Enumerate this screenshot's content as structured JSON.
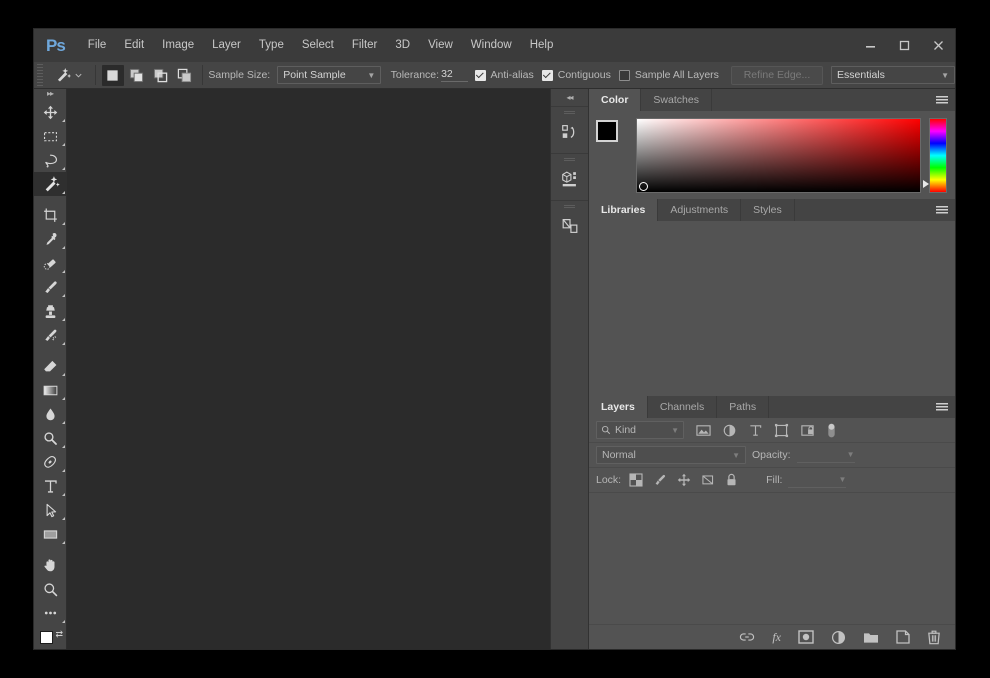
{
  "app": {
    "name": "Adobe Photoshop",
    "logo": "Ps",
    "logo_color": "#6fa8dc",
    "canvas_bg": "#2b2b2b",
    "panel_bg": "#535353",
    "chrome_bg": "#454545"
  },
  "menubar": {
    "items": [
      {
        "label": "File"
      },
      {
        "label": "Edit"
      },
      {
        "label": "Image"
      },
      {
        "label": "Layer"
      },
      {
        "label": "Type"
      },
      {
        "label": "Select"
      },
      {
        "label": "Filter"
      },
      {
        "label": "3D"
      },
      {
        "label": "View"
      },
      {
        "label": "Window"
      },
      {
        "label": "Help"
      }
    ]
  },
  "window_controls": {
    "minimize": "minimize-icon",
    "maximize": "maximize-icon",
    "close": "close-icon"
  },
  "options_bar": {
    "active_tool_icon": "magic-wand-icon",
    "selection_modes": [
      {
        "name": "new-selection",
        "active": true
      },
      {
        "name": "add-to-selection",
        "active": false
      },
      {
        "name": "subtract-from-selection",
        "active": false
      },
      {
        "name": "intersect-with-selection",
        "active": false
      }
    ],
    "sample_size_label": "Sample Size:",
    "sample_size_value": "Point Sample",
    "tolerance_label": "Tolerance:",
    "tolerance_value": "32",
    "anti_alias_label": "Anti-alias",
    "anti_alias_checked": true,
    "contiguous_label": "Contiguous",
    "contiguous_checked": true,
    "sample_all_layers_label": "Sample All Layers",
    "sample_all_layers_checked": false,
    "refine_edge_label": "Refine Edge...",
    "refine_edge_disabled": true,
    "workspace_value": "Essentials"
  },
  "toolbar": {
    "expand_icon": "double-chevron-right-icon",
    "tools": [
      {
        "name": "move-tool",
        "icon": "move-icon",
        "active": false,
        "has_menu": true
      },
      {
        "name": "rectangular-marquee-tool",
        "icon": "marquee-icon",
        "active": false,
        "has_menu": true
      },
      {
        "name": "lasso-tool",
        "icon": "lasso-icon",
        "active": false,
        "has_menu": true
      },
      {
        "name": "magic-wand-tool",
        "icon": "magic-wand-icon",
        "active": true,
        "has_menu": true
      },
      {
        "name": "crop-tool",
        "icon": "crop-icon",
        "active": false,
        "has_menu": true
      },
      {
        "name": "eyedropper-tool",
        "icon": "eyedropper-icon",
        "active": false,
        "has_menu": true
      },
      {
        "name": "spot-healing-brush-tool",
        "icon": "healing-brush-icon",
        "active": false,
        "has_menu": true
      },
      {
        "name": "brush-tool",
        "icon": "brush-icon",
        "active": false,
        "has_menu": true
      },
      {
        "name": "clone-stamp-tool",
        "icon": "clone-stamp-icon",
        "active": false,
        "has_menu": true
      },
      {
        "name": "history-brush-tool",
        "icon": "history-brush-icon",
        "active": false,
        "has_menu": true
      },
      {
        "name": "eraser-tool",
        "icon": "eraser-icon",
        "active": false,
        "has_menu": true
      },
      {
        "name": "gradient-tool",
        "icon": "gradient-icon",
        "active": false,
        "has_menu": true
      },
      {
        "name": "blur-tool",
        "icon": "blur-droplet-icon",
        "active": false,
        "has_menu": true
      },
      {
        "name": "dodge-tool",
        "icon": "dodge-icon",
        "active": false,
        "has_menu": true
      },
      {
        "name": "pen-tool",
        "icon": "pen-icon",
        "active": false,
        "has_menu": true
      },
      {
        "name": "type-tool",
        "icon": "type-t-icon",
        "active": false,
        "has_menu": true
      },
      {
        "name": "path-selection-tool",
        "icon": "path-arrow-icon",
        "active": false,
        "has_menu": true
      },
      {
        "name": "rectangle-tool",
        "icon": "rectangle-icon",
        "active": false,
        "has_menu": true
      },
      {
        "name": "hand-tool",
        "icon": "hand-icon",
        "active": false,
        "has_menu": false
      },
      {
        "name": "zoom-tool",
        "icon": "magnifier-icon",
        "active": false,
        "has_menu": false
      },
      {
        "name": "edit-toolbar",
        "icon": "ellipsis-icon",
        "active": false,
        "has_menu": true
      }
    ],
    "foreground_color": "#ffffff",
    "background_color": "#efefef",
    "swap_icon": "swap-colors-icon"
  },
  "mini_dock": {
    "collapse_icon": "double-chevron-left-icon",
    "buttons": [
      {
        "name": "history-panel-button",
        "icon": "history-icon"
      },
      {
        "name": "3d-panel-button",
        "icon": "cube-icon"
      },
      {
        "name": "properties-panel-button",
        "icon": "properties-icon"
      }
    ]
  },
  "color_panel": {
    "tabs": [
      {
        "label": "Color",
        "active": true
      },
      {
        "label": "Swatches",
        "active": false
      }
    ],
    "menu_icon": "panel-menu-icon",
    "foreground_color": "#000000",
    "background_color": "#ffffff",
    "gradient_hue": "#ff0000"
  },
  "libraries_panel": {
    "tabs": [
      {
        "label": "Libraries",
        "active": true
      },
      {
        "label": "Adjustments",
        "active": false
      },
      {
        "label": "Styles",
        "active": false
      }
    ],
    "menu_icon": "panel-menu-icon"
  },
  "layers_panel": {
    "tabs": [
      {
        "label": "Layers",
        "active": true
      },
      {
        "label": "Channels",
        "active": false
      },
      {
        "label": "Paths",
        "active": false
      }
    ],
    "menu_icon": "panel-menu-icon",
    "filter_label": "Kind",
    "filter_search_icon": "search-icon",
    "filter_icons": [
      {
        "name": "filter-pixel-layers-icon"
      },
      {
        "name": "filter-adjustment-layers-icon"
      },
      {
        "name": "filter-type-layers-icon"
      },
      {
        "name": "filter-shape-layers-icon"
      },
      {
        "name": "filter-smart-object-icon"
      }
    ],
    "filter_toggle_icon": "filter-toggle-icon",
    "blend_mode": "Normal",
    "opacity_label": "Opacity:",
    "opacity_value": "",
    "lock_label": "Lock:",
    "lock_icons": [
      {
        "name": "lock-transparent-pixels-icon"
      },
      {
        "name": "lock-image-pixels-icon"
      },
      {
        "name": "lock-position-icon"
      },
      {
        "name": "lock-artboard-icon"
      },
      {
        "name": "lock-all-icon"
      }
    ],
    "fill_label": "Fill:",
    "fill_value": "",
    "bottom_buttons": [
      {
        "name": "link-layers-button",
        "icon": "link-icon"
      },
      {
        "name": "layer-style-button",
        "icon": "fx-icon",
        "label": "fx"
      },
      {
        "name": "add-layer-mask-button",
        "icon": "mask-icon"
      },
      {
        "name": "new-adjustment-layer-button",
        "icon": "adjustment-circle-icon"
      },
      {
        "name": "new-group-button",
        "icon": "folder-icon"
      },
      {
        "name": "new-layer-button",
        "icon": "new-layer-icon"
      },
      {
        "name": "delete-layer-button",
        "icon": "trash-icon"
      }
    ]
  }
}
